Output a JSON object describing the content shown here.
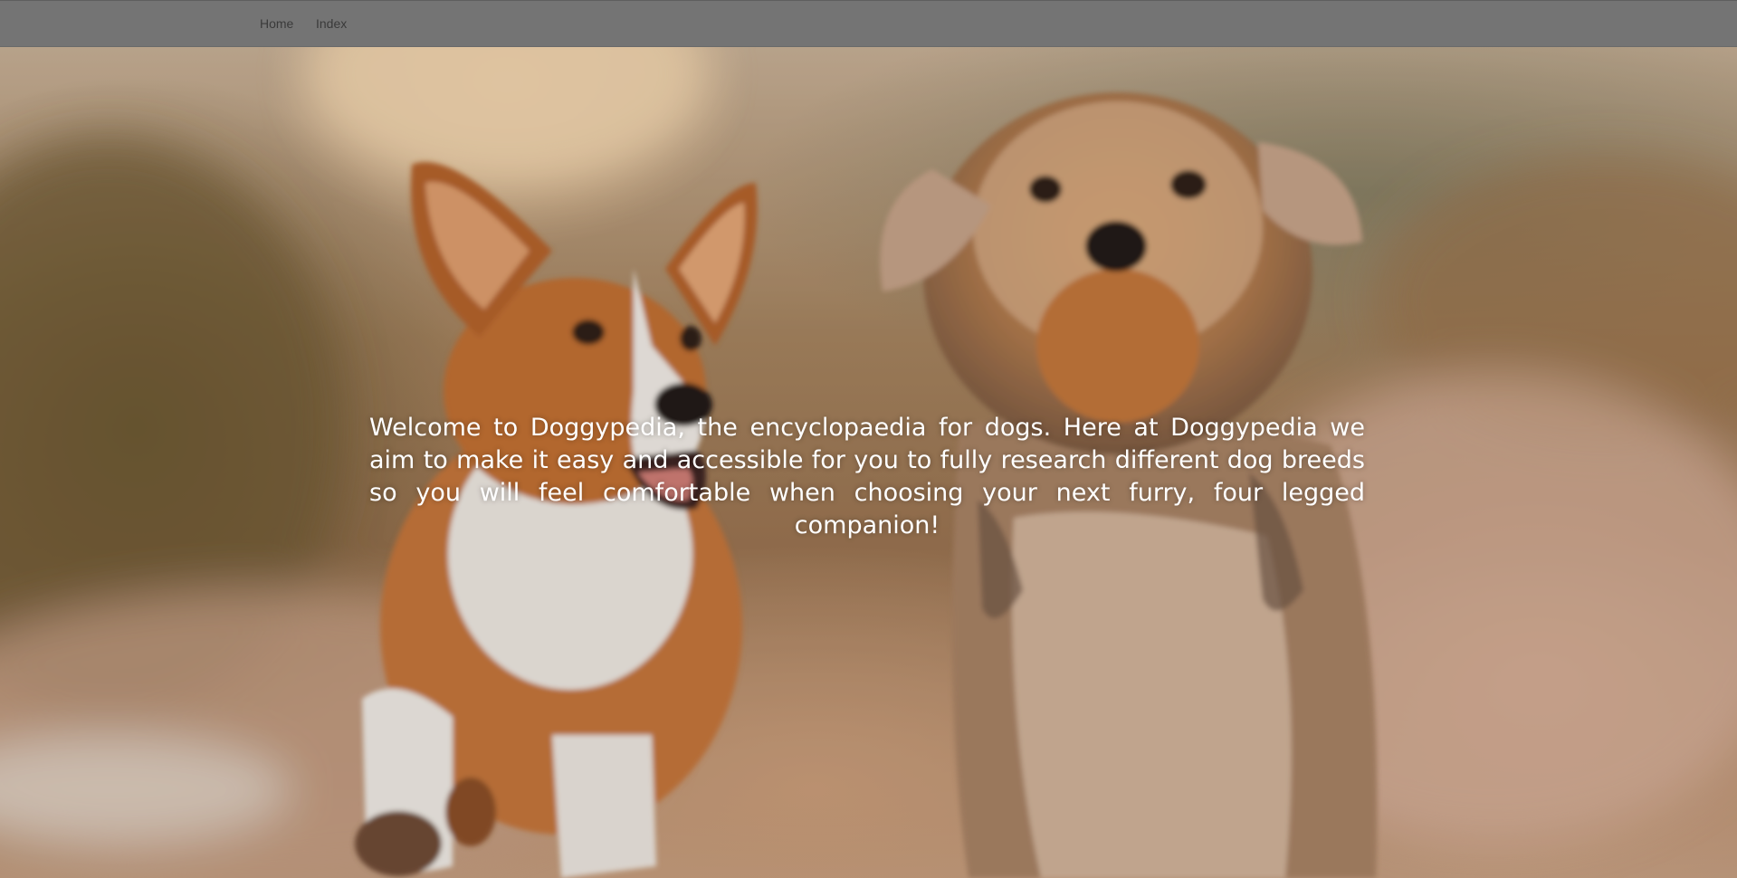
{
  "nav": {
    "links": [
      {
        "label": "Home"
      },
      {
        "label": "Index"
      }
    ]
  },
  "hero": {
    "image_subject": "corgi-and-terrier-running-on-dirt-path",
    "welcome_text": "Welcome to Doggypedia, the encyclopaedia for dogs. Here at Doggypedia we aim to make it easy and accessible for you to fully research different dog breeds so you will feel comfortable when choosing your next furry, four legged companion!"
  },
  "colors": {
    "navbar_background": "#747474",
    "nav_link_text": "#3a3a3a",
    "hero_text": "#ffffff"
  }
}
